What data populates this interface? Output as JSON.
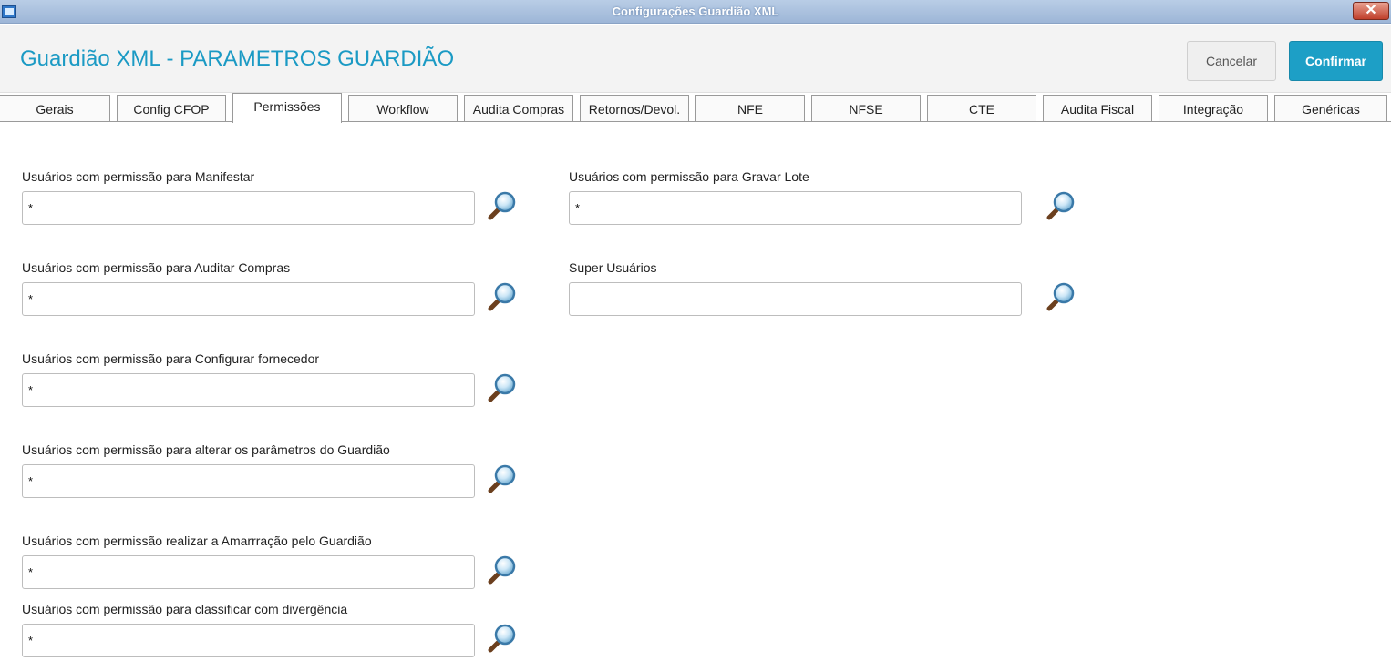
{
  "window": {
    "title": "Configurações Guardião XML"
  },
  "header": {
    "title": "Guardião XML - PARAMETROS GUARDIÃO",
    "cancel_label": "Cancelar",
    "confirm_label": "Confirmar"
  },
  "tabs": [
    {
      "label": "Gerais"
    },
    {
      "label": "Config CFOP"
    },
    {
      "label": "Permissões",
      "active": true
    },
    {
      "label": "Workflow"
    },
    {
      "label": "Audita Compras"
    },
    {
      "label": "Retornos/Devol."
    },
    {
      "label": "NFE"
    },
    {
      "label": "NFSE"
    },
    {
      "label": "CTE"
    },
    {
      "label": "Audita Fiscal"
    },
    {
      "label": "Integração"
    },
    {
      "label": "Genéricas"
    }
  ],
  "fields": {
    "manifestar": {
      "label": "Usuários com permissão para Manifestar",
      "value": "*"
    },
    "gravar_lote": {
      "label": "Usuários com permissão para Gravar Lote",
      "value": "*"
    },
    "auditar_compras": {
      "label": "Usuários com permissão para Auditar Compras",
      "value": "*"
    },
    "super_usuarios": {
      "label": "Super Usuários",
      "value": ""
    },
    "configurar_fornecedor": {
      "label": "Usuários com permissão para Configurar fornecedor",
      "value": "*"
    },
    "alterar_parametros": {
      "label": "Usuários com permissão para alterar os parâmetros do Guardião",
      "value": "*"
    },
    "amarracao": {
      "label": "Usuários com permissão realizar a Amarrração pelo Guardião",
      "value": "*"
    },
    "classificar_divergencia": {
      "label": "Usuários com permissão para classificar com divergência",
      "value": "*"
    }
  },
  "icons": {
    "lookup": "magnifier-icon",
    "close": "close-icon"
  },
  "colors": {
    "accent": "#1d9fc6",
    "title": "#1b9ac4"
  }
}
